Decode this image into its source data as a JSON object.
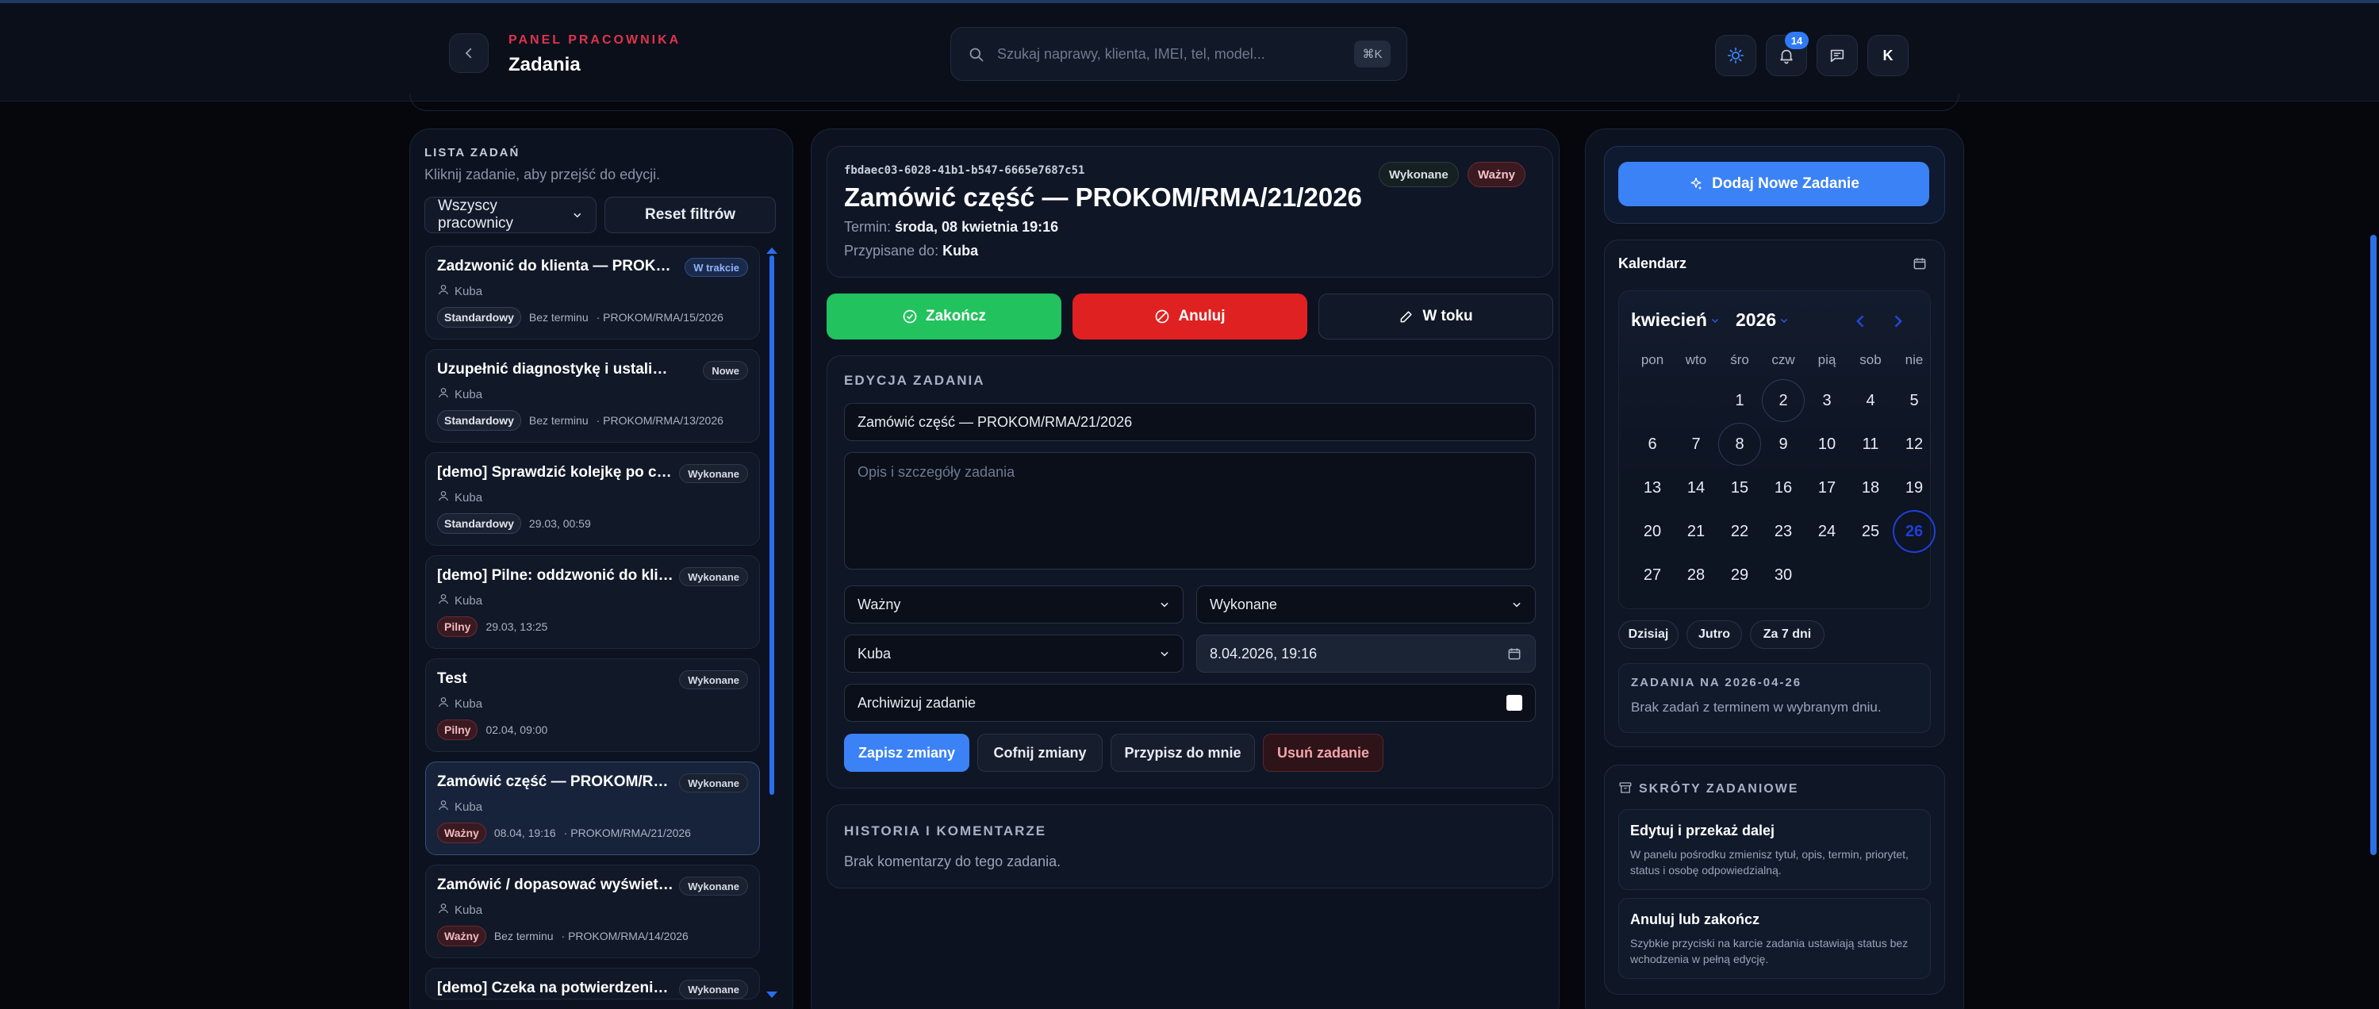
{
  "header": {
    "panel_label": "PANEL PRACOWNIKA",
    "title": "Zadania",
    "search_placeholder": "Szukaj naprawy, klienta, IMEI, tel, model...",
    "search_shortcut": "⌘K",
    "notifications_count": "14",
    "avatar_initial": "K"
  },
  "sidebar": {
    "heading": "LISTA ZADAŃ",
    "hint": "Kliknij zadanie, aby przejść do edycji.",
    "filter_select": "Wszyscy pracownicy",
    "reset_label": "Reset filtrów",
    "tasks": [
      {
        "title": "Zadzwonić do klienta — PROKOM/...",
        "status": "W trakcie",
        "user": "Kuba",
        "priority": "Standardowy",
        "date": "Bez terminu",
        "ref": "· PROKOM/RMA/15/2026"
      },
      {
        "title": "Uzupełnić diagnostykę i ustalić kolejn...",
        "status": "Nowe",
        "user": "Kuba",
        "priority": "Standardowy",
        "date": "Bez terminu",
        "ref": "· PROKOM/RMA/13/2026"
      },
      {
        "title": "[demo] Sprawdzić kolejkę po częś...",
        "status": "Wykonane",
        "user": "Kuba",
        "priority": "Standardowy",
        "date": "29.03, 00:59",
        "ref": ""
      },
      {
        "title": "[demo] Pilne: oddzwonić do klient...",
        "status": "Wykonane",
        "user": "Kuba",
        "priority": "Pilny",
        "date": "29.03, 13:25",
        "ref": ""
      },
      {
        "title": "Test",
        "status": "Wykonane",
        "user": "Kuba",
        "priority": "Pilny",
        "date": "02.04, 09:00",
        "ref": ""
      },
      {
        "title": "Zamówić część — PROKOM/RMA/...",
        "status": "Wykonane",
        "user": "Kuba",
        "priority": "Ważny",
        "date": "08.04, 19:16",
        "ref": "· PROKOM/RMA/21/2026"
      },
      {
        "title": "Zamówić / dopasować wyświetlacz",
        "status": "Wykonane",
        "user": "Kuba",
        "priority": "Ważny",
        "date": "Bez terminu",
        "ref": "· PROKOM/RMA/14/2026"
      },
      {
        "title": "[demo] Czeka na potwierdzenie d...",
        "status": "Wykonane",
        "user": "",
        "priority": "",
        "date": "",
        "ref": ""
      }
    ]
  },
  "detail": {
    "id": "fbdaec03-6028-41b1-b547-6665e7687c51",
    "status_pill": "Wykonane",
    "priority_pill": "Ważny",
    "title": "Zamówić część — PROKOM/RMA/21/2026",
    "deadline_label": "Termin:",
    "deadline_value": "środa, 08 kwietnia 19:16",
    "assigned_label": "Przypisane do:",
    "assigned_value": "Kuba",
    "actions": {
      "complete": "Zakończ",
      "cancel": "Anuluj",
      "in_progress": "W toku"
    }
  },
  "edit": {
    "heading": "EDYCJA ZADANIA",
    "title_value": "Zamówić część — PROKOM/RMA/21/2026",
    "description_placeholder": "Opis i szczegóły zadania",
    "priority_value": "Ważny",
    "status_value": "Wykonane",
    "assignee_value": "Kuba",
    "datetime_value": "8.04.2026, 19:16",
    "archive_label": "Archiwizuj zadanie",
    "buttons": {
      "save": "Zapisz zmiany",
      "revert": "Cofnij zmiany",
      "assign_me": "Przypisz do mnie",
      "delete": "Usuń zadanie"
    }
  },
  "history": {
    "heading": "HISTORIA I KOMENTARZE",
    "empty": "Brak komentarzy do tego zadania."
  },
  "right": {
    "add_button": "Dodaj Nowe Zadanie",
    "calendar_title": "Kalendarz",
    "month": "kwiecień",
    "year": "2026",
    "weekdays": [
      "pon",
      "wto",
      "śro",
      "czw",
      "pią",
      "sob",
      "nie"
    ],
    "days": [
      "1",
      "2",
      "3",
      "4",
      "5",
      "6",
      "7",
      "8",
      "9",
      "10",
      "11",
      "12",
      "13",
      "14",
      "15",
      "16",
      "17",
      "18",
      "19",
      "20",
      "21",
      "22",
      "23",
      "24",
      "25",
      "26",
      "27",
      "28",
      "29",
      "30"
    ],
    "quick": [
      "Dzisiaj",
      "Jutro",
      "Za 7 dni"
    ],
    "tasks_on_heading": "ZADANIA NA 2026-04-26",
    "tasks_on_empty": "Brak zadań z terminem w wybranym dniu.",
    "shortcuts_heading": "SKRÓTY ZADANIOWE",
    "shortcuts": [
      {
        "title": "Edytuj i przekaż dalej",
        "text": "W panelu pośrodku zmienisz tytuł, opis, termin, priorytet, status i osobę odpowiedzialną."
      },
      {
        "title": "Anuluj lub zakończ",
        "text": "Szybkie przyciski na karcie zadania ustawiają status bez wchodzenia w pełną edycję."
      }
    ]
  },
  "colors": {
    "accent": "#2f7bf5",
    "success": "#22c25e",
    "danger": "#e02121",
    "brand_red": "#e0334c"
  }
}
